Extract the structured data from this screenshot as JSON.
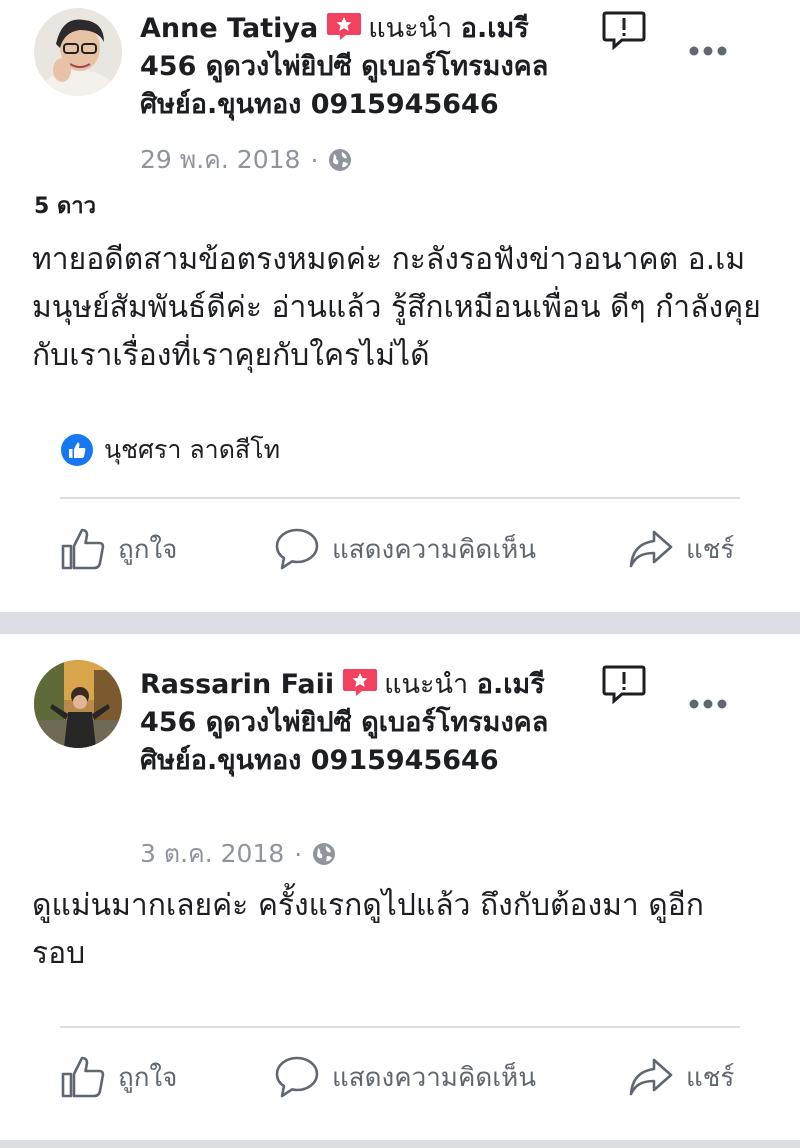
{
  "posts": [
    {
      "author": "Anne Tatiya",
      "recommend_text": "แนะนำ",
      "page_name": "อ.เมรี 456 ดูดวงไพ่ยิปซี ดูเบอร์โทรมงคล ศิษย์อ.ขุนทอง 0915945646",
      "date": "29 พ.ค. 2018",
      "rating": "5 ดาว",
      "body": "ทายอดีตสามข้อตรงหมดค่ะ กะลังรอฟังข่าวอนาคต อ.เม มนุษย์สัมพันธ์ดีค่ะ อ่านแล้ว รู้สึกเหมือนเพื่อน ดีๆ กำลังคุยกับเราเรื่องที่เราคุยกับใครไม่ได้",
      "liked_by": "นุชศรา ลาดสีโท"
    },
    {
      "author": "Rassarin Faii",
      "recommend_text": "แนะนำ",
      "page_name": "อ.เมรี 456 ดูดวงไพ่ยิปซี ดูเบอร์โทรมงคล ศิษย์อ.ขุนทอง 0915945646",
      "date": "3 ต.ค. 2018",
      "body": "ดูแม่นมากเลยค่ะ ครั้งแรกดูไปแล้ว ถึงกับต้องมา ดูอีกรอบ"
    }
  ],
  "actions": {
    "like": "ถูกใจ",
    "comment": "แสดงความคิดเห็น",
    "share": "แชร์"
  },
  "colors": {
    "badge": "#f3425f",
    "like_blue": "#1877f2",
    "muted": "#90949c",
    "separator": "#dcdee3"
  },
  "icons": [
    "recommend-badge-icon",
    "report-icon",
    "more-options-icon",
    "globe-icon",
    "like-reaction-icon",
    "thumbs-up-icon",
    "comment-icon",
    "share-icon"
  ]
}
